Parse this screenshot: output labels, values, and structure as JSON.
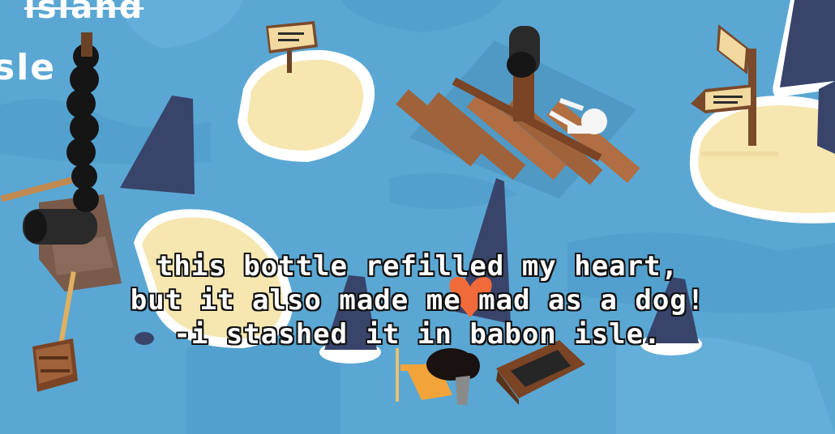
{
  "map_labels": {
    "island_label": "island",
    "isle_label": "sle"
  },
  "dialogue": {
    "line1": "this bottle refilled my heart,",
    "line2": "but it also made me mad as a dog!",
    "line3": "-i stashed it in babon isle."
  },
  "colors": {
    "ocean": "#5aa7d4",
    "ocean_dark": "#4a95c4",
    "sand": "#f6e6b0",
    "sand_edge": "#ffffff",
    "rock": "#39446b",
    "wood": "#a0623a",
    "wood_dark": "#7a4425",
    "smoke": "#1b1b1b",
    "heart": "#f06a3a",
    "player_body": "#f2a43a",
    "player_hair": "#1a1210"
  }
}
